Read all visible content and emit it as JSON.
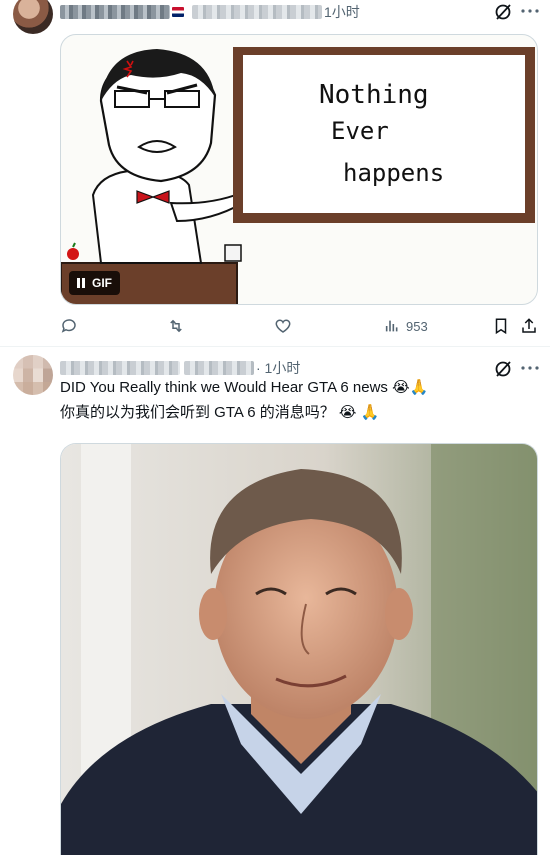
{
  "post1": {
    "time": "1小时",
    "gif": {
      "board_line1": "Nothing",
      "board_line2": "Ever",
      "board_line3": "happens",
      "badge_label": "GIF"
    },
    "actions": {
      "views_count": "953"
    }
  },
  "post2": {
    "time": "· 1小时",
    "text_line1": "DID  You Really think  we Would Hear GTA 6 news 😭🙏",
    "text_line2": "你真的以为我们会听到 GTA 6 的消息吗？ 😭  🙏"
  },
  "colors": {
    "text_primary": "#0f1419",
    "text_secondary": "#536471",
    "border": "#cfd9de",
    "board_frame": "#6b3f2a",
    "bowtie": "#c8141c"
  },
  "icons": [
    "grok-icon",
    "more-icon",
    "reply-icon",
    "repost-icon",
    "like-icon",
    "views-icon",
    "bookmark-icon",
    "share-icon",
    "pause-icon"
  ]
}
